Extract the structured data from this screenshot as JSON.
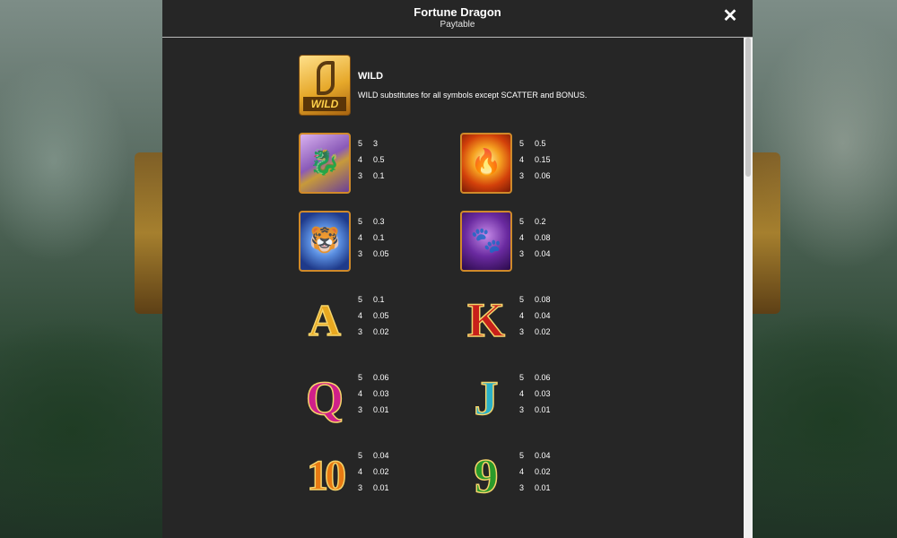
{
  "header": {
    "title": "Fortune Dragon",
    "subtitle": "Paytable"
  },
  "wild": {
    "icon": "wild-dragon-icon",
    "icon_text": "WILD",
    "name": "WILD",
    "description": "WILD substitutes for all symbols except SCATTER and BONUS."
  },
  "symbols": [
    {
      "icon": "golden-dragon-icon",
      "pays": [
        {
          "count": "5",
          "value": "3"
        },
        {
          "count": "4",
          "value": "0.5"
        },
        {
          "count": "3",
          "value": "0.1"
        }
      ]
    },
    {
      "icon": "phoenix-icon",
      "pays": [
        {
          "count": "5",
          "value": "0.5"
        },
        {
          "count": "4",
          "value": "0.15"
        },
        {
          "count": "3",
          "value": "0.06"
        }
      ]
    },
    {
      "icon": "white-tiger-icon",
      "pays": [
        {
          "count": "5",
          "value": "0.3"
        },
        {
          "count": "4",
          "value": "0.1"
        },
        {
          "count": "3",
          "value": "0.05"
        }
      ]
    },
    {
      "icon": "black-panther-icon",
      "pays": [
        {
          "count": "5",
          "value": "0.2"
        },
        {
          "count": "4",
          "value": "0.08"
        },
        {
          "count": "3",
          "value": "0.04"
        }
      ]
    },
    {
      "icon": "letter-a-icon",
      "letter": "A",
      "pays": [
        {
          "count": "5",
          "value": "0.1"
        },
        {
          "count": "4",
          "value": "0.05"
        },
        {
          "count": "3",
          "value": "0.02"
        }
      ]
    },
    {
      "icon": "letter-k-icon",
      "letter": "K",
      "pays": [
        {
          "count": "5",
          "value": "0.08"
        },
        {
          "count": "4",
          "value": "0.04"
        },
        {
          "count": "3",
          "value": "0.02"
        }
      ]
    },
    {
      "icon": "letter-q-icon",
      "letter": "Q",
      "pays": [
        {
          "count": "5",
          "value": "0.06"
        },
        {
          "count": "4",
          "value": "0.03"
        },
        {
          "count": "3",
          "value": "0.01"
        }
      ]
    },
    {
      "icon": "letter-j-icon",
      "letter": "J",
      "pays": [
        {
          "count": "5",
          "value": "0.06"
        },
        {
          "count": "4",
          "value": "0.03"
        },
        {
          "count": "3",
          "value": "0.01"
        }
      ]
    },
    {
      "icon": "number-10-icon",
      "letter": "10",
      "pays": [
        {
          "count": "5",
          "value": "0.04"
        },
        {
          "count": "4",
          "value": "0.02"
        },
        {
          "count": "3",
          "value": "0.01"
        }
      ]
    },
    {
      "icon": "number-9-icon",
      "letter": "9",
      "pays": [
        {
          "count": "5",
          "value": "0.04"
        },
        {
          "count": "4",
          "value": "0.02"
        },
        {
          "count": "3",
          "value": "0.01"
        }
      ]
    }
  ],
  "scrollbar": {
    "position": 0.0
  }
}
